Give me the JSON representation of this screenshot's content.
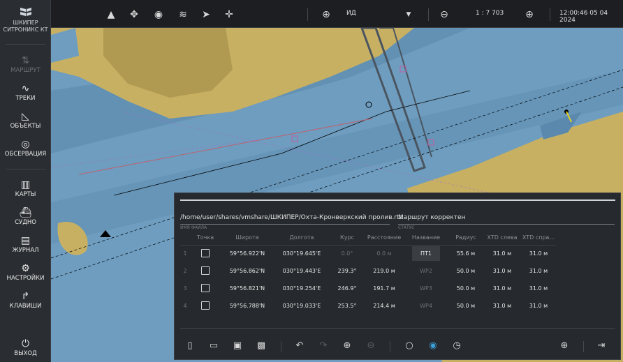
{
  "sidebar": {
    "logo_line1": "ШКИПЕР",
    "logo_line2": "СИТРОНИКС КТ",
    "items": [
      {
        "label": "МАРШРУТ",
        "icon": "route-icon"
      },
      {
        "label": "ТРЕКИ",
        "icon": "tracks-icon"
      },
      {
        "label": "ОБЪЕКТЫ",
        "icon": "objects-icon"
      },
      {
        "label": "ОБСЕРВАЦИЯ",
        "icon": "observation-icon"
      },
      {
        "label": "КАРТЫ",
        "icon": "map-icon"
      },
      {
        "label": "СУДНО",
        "icon": "ship-icon"
      },
      {
        "label": "ЖУРНАЛ",
        "icon": "journal-icon"
      },
      {
        "label": "НАСТРОЙКИ",
        "icon": "gear-icon"
      },
      {
        "label": "КЛАВИШИ",
        "icon": "keys-icon"
      },
      {
        "label": "ВЫХОД",
        "icon": "power-icon"
      }
    ]
  },
  "topbar": {
    "mode_value": "ИД",
    "scale": "1 : 7 703",
    "datetime": "12:00:46 05 04 2024"
  },
  "panel": {
    "file_path": "/home/user/shares/vmshare/ШКИПЕР/Охта-Кронверкский пролив.rtz",
    "file_label": "ИМЯ ФАЙЛА",
    "status": "Маршрут корректен",
    "status_label": "СТАТУС",
    "columns": [
      "Точка",
      "Широта",
      "Долгота",
      "Курс",
      "Расстояние",
      "Название",
      "Радиус",
      "XTD слева",
      "XTD спра..."
    ],
    "rows": [
      {
        "n": "1",
        "lat": "59°56.922'N",
        "lon": "030°19.645'E",
        "course": "0.0°",
        "dist": "0.0 м",
        "name": "ПТ1",
        "radius": "55.6 м",
        "xl": "31.0 м",
        "xr": "31.0 м"
      },
      {
        "n": "2",
        "lat": "59°56.862'N",
        "lon": "030°19.443'E",
        "course": "239.3°",
        "dist": "219.0 м",
        "name": "WP2",
        "radius": "50.0 м",
        "xl": "31.0 м",
        "xr": "31.0 м"
      },
      {
        "n": "3",
        "lat": "59°56.821'N",
        "lon": "030°19.254'E",
        "course": "246.9°",
        "dist": "191.7 м",
        "name": "WP3",
        "radius": "50.0 м",
        "xl": "31.0 м",
        "xr": "31.0 м"
      },
      {
        "n": "4",
        "lat": "59°56.788'N",
        "lon": "030°19.033'E",
        "course": "253.5°",
        "dist": "214.4 м",
        "name": "WP4",
        "radius": "50.0 м",
        "xl": "31.0 м",
        "xr": "31.0 м"
      }
    ]
  },
  "colors": {
    "water": "#6e9dbf",
    "shallow": "#5a89ad",
    "land": "#c8b063",
    "buildings": "#b09a52",
    "panel_bg": "#26292d",
    "accent": "#3aa0d8"
  }
}
